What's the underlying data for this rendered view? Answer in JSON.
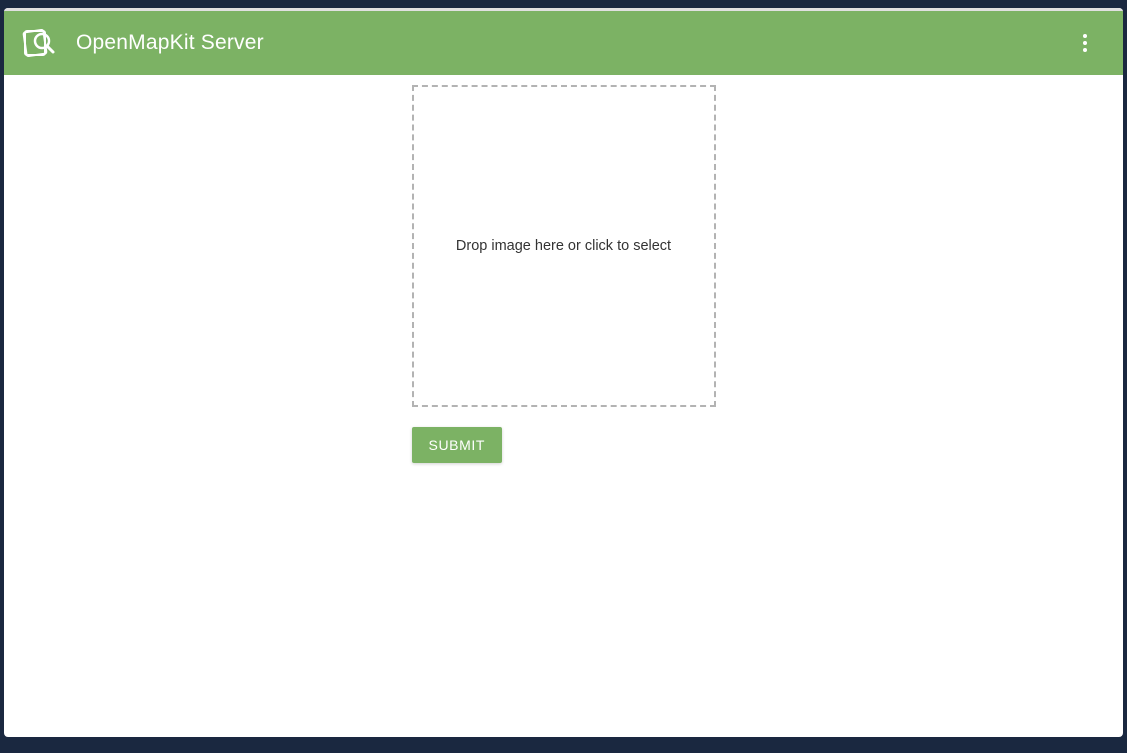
{
  "header": {
    "title": "OpenMapKit Server"
  },
  "dropzone": {
    "prompt": "Drop image here or click to select"
  },
  "actions": {
    "submit_label": "SUBMIT"
  },
  "colors": {
    "primary": "#7cb264"
  }
}
